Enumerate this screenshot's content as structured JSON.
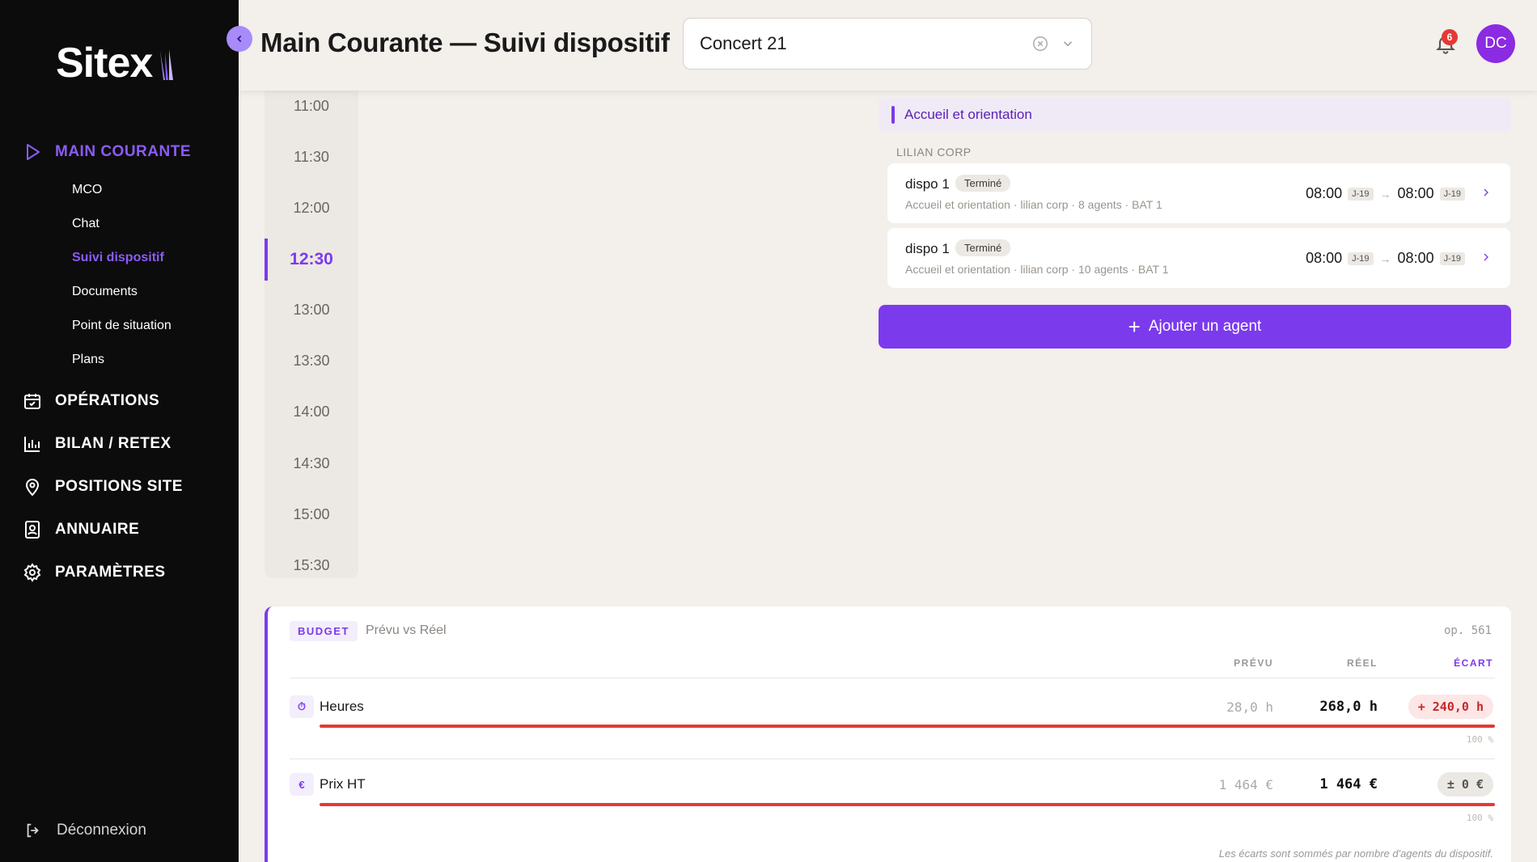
{
  "sidebar": {
    "logo": "Sitex",
    "sections": [
      {
        "label": "MAIN COURANTE",
        "icon": "play-icon",
        "active": true,
        "items": [
          {
            "label": "MCO"
          },
          {
            "label": "Chat"
          },
          {
            "label": "Suivi dispositif",
            "active": true
          },
          {
            "label": "Documents"
          },
          {
            "label": "Point de situation"
          },
          {
            "label": "Plans"
          }
        ]
      },
      {
        "label": "OPÉRATIONS",
        "icon": "calendar-check-icon"
      },
      {
        "label": "BILAN / RETEX",
        "icon": "bar-chart-icon"
      },
      {
        "label": "POSITIONS SITE",
        "icon": "map-pin-icon"
      },
      {
        "label": "ANNUAIRE",
        "icon": "contact-book-icon"
      },
      {
        "label": "PARAMÈTRES",
        "icon": "gear-icon"
      }
    ],
    "logout": "Déconnexion"
  },
  "header": {
    "title": "Main Courante — Suivi dispositif",
    "event_select": "Concert 21",
    "notifications": "6",
    "avatar": "DC"
  },
  "timeline": [
    "11:00",
    "11:30",
    "12:00",
    "12:30",
    "13:00",
    "13:30",
    "14:00",
    "14:30",
    "15:00",
    "15:30"
  ],
  "timeline_active": "12:30",
  "mission": {
    "section": "Accueil et orientation",
    "group": "LILIAN CORP",
    "dispos": [
      {
        "name": "dispo 1",
        "status": "Terminé",
        "meta": "Accueil et orientation · lilian corp · 8 agents · BAT 1",
        "start": "08:00",
        "start_tag": "J-19",
        "end": "08:00",
        "end_tag": "J-19"
      },
      {
        "name": "dispo 1",
        "status": "Terminé",
        "meta": "Accueil et orientation · lilian corp · 10 agents · BAT 1",
        "start": "08:00",
        "start_tag": "J-19",
        "end": "08:00",
        "end_tag": "J-19"
      }
    ],
    "add_button": "Ajouter un agent"
  },
  "budget": {
    "tag": "BUDGET",
    "subtitle": "Prévu vs Réel",
    "op": "op. 561",
    "columns": {
      "prevu": "PRÉVU",
      "reel": "RÉEL",
      "ecart": "ÉCART"
    },
    "rows": [
      {
        "icon": "⏱",
        "label": "Heures",
        "prevu": "28,0 h",
        "reel": "268,0 h",
        "ecart": "+ 240,0 h",
        "ecart_color": "red",
        "pct": "100 %",
        "progress": 1.0
      },
      {
        "icon": "€",
        "label": "Prix HT",
        "prevu": "1 464 €",
        "reel": "1 464 €",
        "ecart": "± 0 €",
        "ecart_color": "grey",
        "pct": "100 %",
        "progress": 1.0
      }
    ],
    "footnote": "Les écarts sont sommés par nombre d'agents du dispositif.",
    "accent": "#7c3aed",
    "alert": "#e53935"
  }
}
